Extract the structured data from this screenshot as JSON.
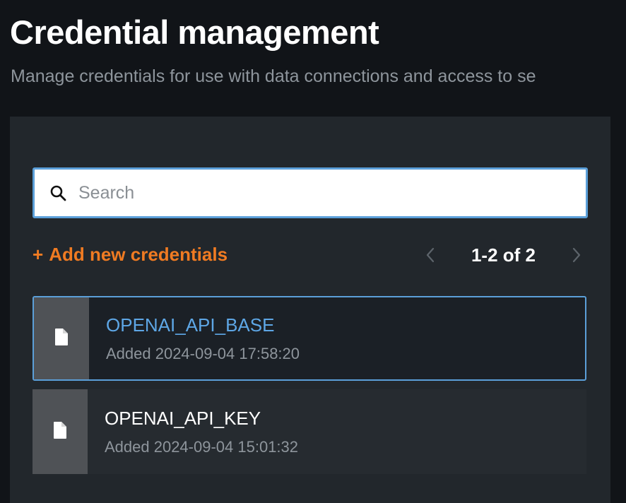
{
  "header": {
    "title": "Credential management",
    "subtitle": "Manage credentials for use with data connections and access to se"
  },
  "search": {
    "placeholder": "Search",
    "value": ""
  },
  "toolbar": {
    "add_label": "Add new credentials",
    "add_icon": "+",
    "pagination": "1-2 of 2"
  },
  "colors": {
    "accent_orange": "#f07b22",
    "accent_blue": "#5b9fd9",
    "background": "#111418",
    "panel": "#22272c"
  },
  "credentials": [
    {
      "name": "OPENAI_API_BASE",
      "added": "Added 2024-09-04 17:58:20",
      "selected": true,
      "icon": "document-icon"
    },
    {
      "name": "OPENAI_API_KEY",
      "added": "Added 2024-09-04 15:01:32",
      "selected": false,
      "icon": "document-icon"
    }
  ]
}
